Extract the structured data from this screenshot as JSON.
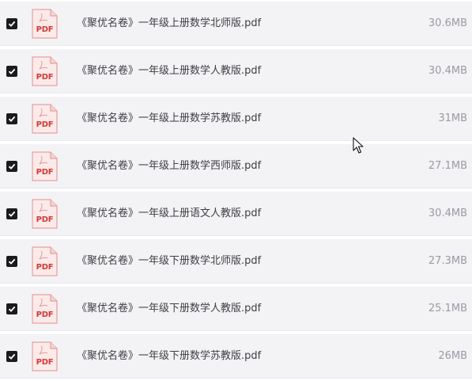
{
  "file_list": {
    "icon_text": "PDF",
    "items": [
      {
        "name": "《聚优名卷》一年级上册数学北师版.pdf",
        "size": "30.6MB",
        "checked": true
      },
      {
        "name": "《聚优名卷》一年级上册数学人教版.pdf",
        "size": "30.4MB",
        "checked": true
      },
      {
        "name": "《聚优名卷》一年级上册数学苏教版.pdf",
        "size": "31MB",
        "checked": true
      },
      {
        "name": "《聚优名卷》一年级上册数学西师版.pdf",
        "size": "27.1MB",
        "checked": true
      },
      {
        "name": "《聚优名卷》一年级上册语文人教版.pdf",
        "size": "30.4MB",
        "checked": true
      },
      {
        "name": "《聚优名卷》一年级下册数学北师版.pdf",
        "size": "27.3MB",
        "checked": true
      },
      {
        "name": "《聚优名卷》一年级下册数学人教版.pdf",
        "size": "25.1MB",
        "checked": true
      },
      {
        "name": "《聚优名卷》一年级下册数学苏教版.pdf",
        "size": "26MB",
        "checked": true
      }
    ]
  },
  "colors": {
    "row_background": "#f3f3f6",
    "checkbox": "#1b1b1b",
    "pdf_red": "#d23a34",
    "name_text": "#3e3e44",
    "size_text": "#9a9aa2"
  },
  "icons": {
    "checkbox": "checkmark-icon",
    "file": "pdf-file-icon",
    "pointer": "mouse-cursor-icon"
  }
}
